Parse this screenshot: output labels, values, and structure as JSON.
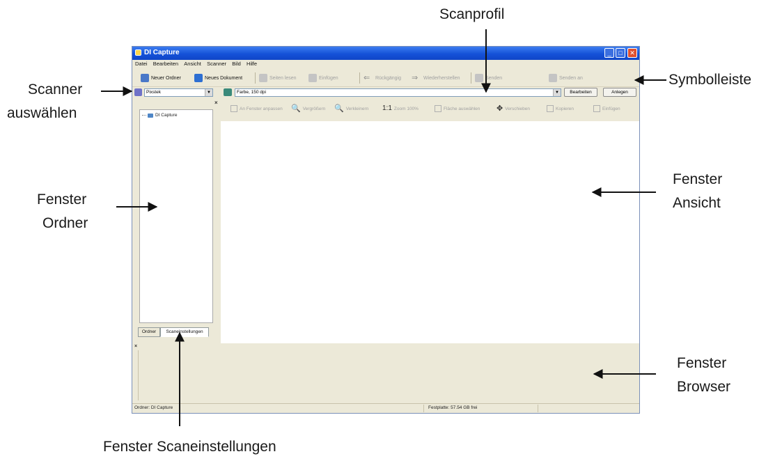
{
  "annotations": {
    "scanprofil": "Scanprofil",
    "symbolleiste": "Symbolleiste",
    "scanner_line1": "Scanner",
    "scanner_line2": "auswählen",
    "ordner_line1": "Fenster",
    "ordner_line2": "Ordner",
    "ansicht_line1": "Fenster",
    "ansicht_line2": "Ansicht",
    "browser_line1": "Fenster",
    "browser_line2": "Browser",
    "scaneinstellungen": "Fenster Scaneinstellungen"
  },
  "window": {
    "title": "DI Capture",
    "menu": [
      "Datei",
      "Bearbeiten",
      "Ansicht",
      "Scanner",
      "Bild",
      "Hilfe"
    ]
  },
  "toolbar": {
    "new_folder": "Neuer Ordner",
    "new_document": "Neues Dokument",
    "scan_images": "Seiten lesen",
    "insert": "Einfügen",
    "undo": "Rückgängig",
    "redo": "Wiederherstellen",
    "send": "Senden",
    "send_to": "Senden an"
  },
  "scanner": {
    "selected": "Pixstek"
  },
  "profile": {
    "selected": "Farbe, 150 dpi",
    "edit_button": "Bearbeiten",
    "create_button": "Anlegen"
  },
  "view_toolbar": {
    "fit_to_window": "An Fenster anpassen",
    "zoom_in": "Vergrößern",
    "zoom_out": "Verkleinern",
    "actual_size_glyph": "1:1",
    "actual_size": "Zoom 100%",
    "select_area": "Fläche auswählen",
    "move": "Verschieben",
    "copy": "Kopieren",
    "paste": "Einfügen"
  },
  "folder_panel": {
    "tree_root": "DI Capture",
    "tab_folder": "Ordner",
    "tab_scan_settings": "Scaneinstellungen"
  },
  "statusbar": {
    "left": "Ordner: DI Capture",
    "right": "Festplatte: 57.54 GB frei"
  },
  "icons": {
    "window_icon": "app-icon",
    "close": "close-icon",
    "zoom": "magnifier-icon"
  },
  "colors": {
    "titlebar": "#1552d8",
    "window_bg": "#ece9d8",
    "close_button": "#e0502f"
  }
}
